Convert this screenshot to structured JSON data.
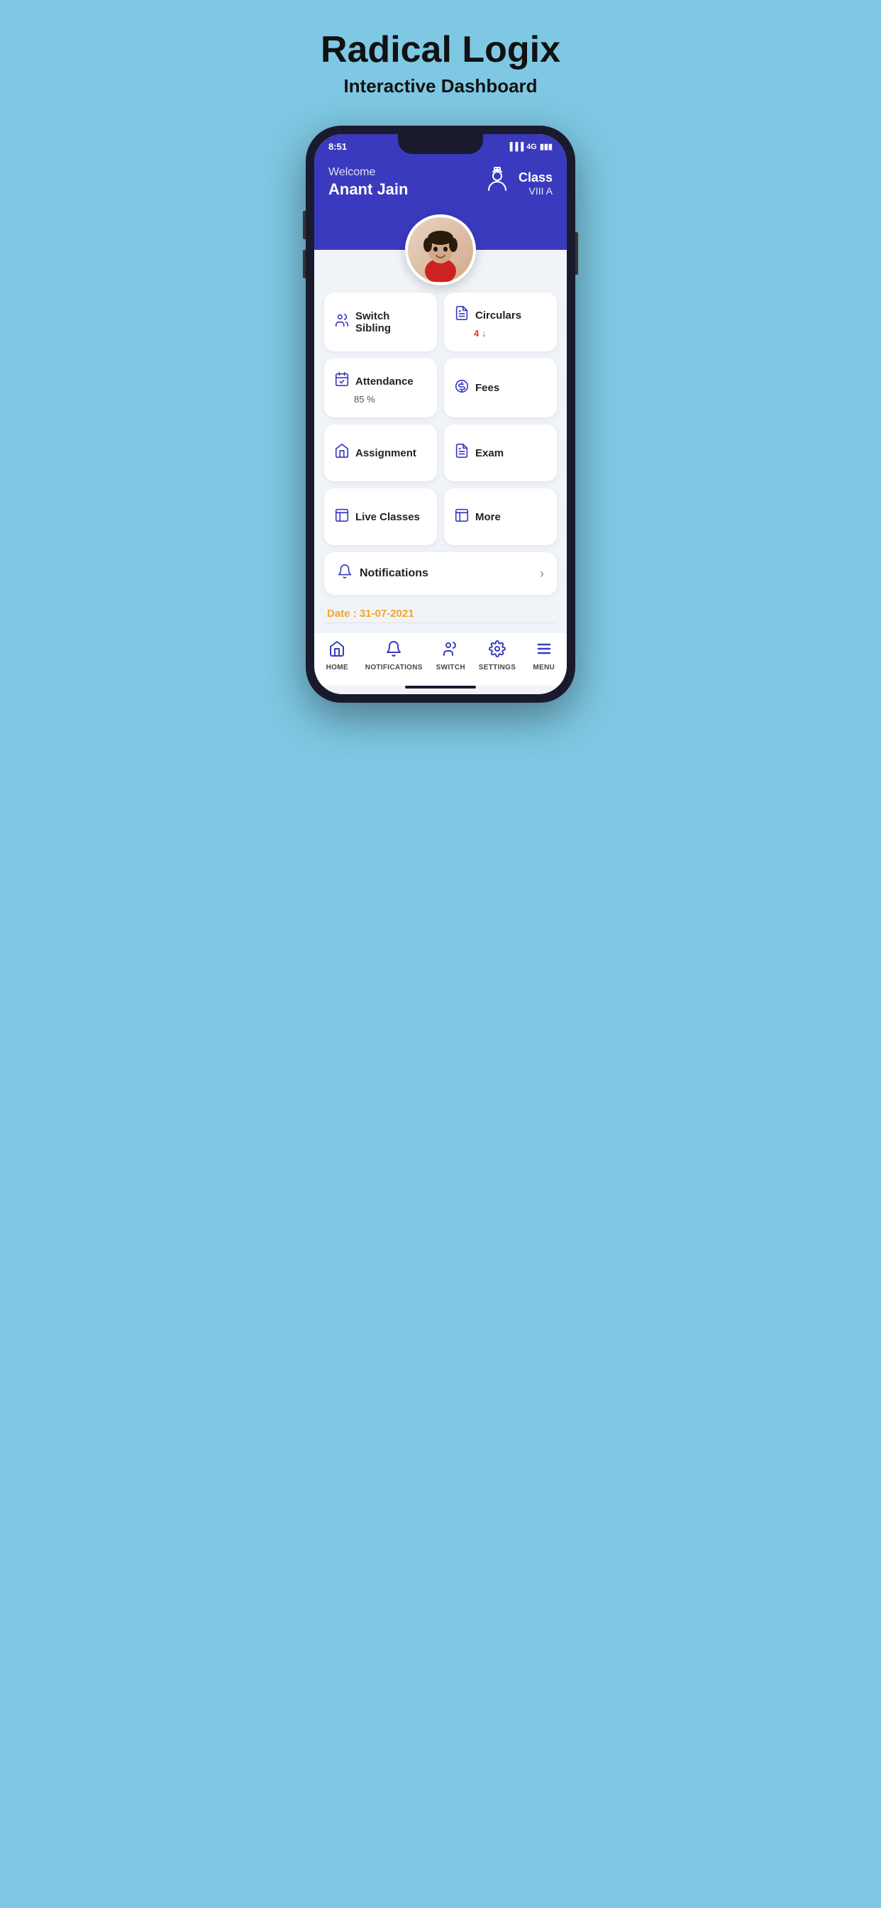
{
  "header": {
    "title": "Radical Logix",
    "subtitle_normal": "Interactive ",
    "subtitle_bold": "Dashboard"
  },
  "status_bar": {
    "time": "8:51",
    "network": "4G"
  },
  "user": {
    "welcome": "Welcome",
    "name": "Anant  Jain",
    "class_label": "Class",
    "class_value": "VIII A"
  },
  "grid_items": [
    {
      "label": "Switch Sibling",
      "sub": "",
      "icon": "switch-sibling"
    },
    {
      "label": "Circulars",
      "sub": "4 ↓",
      "icon": "circulars"
    },
    {
      "label": "Attendance",
      "sub": "85 %",
      "icon": "attendance"
    },
    {
      "label": "Fees",
      "sub": "",
      "icon": "fees"
    },
    {
      "label": "Assignment",
      "sub": "",
      "icon": "assignment"
    },
    {
      "label": "Exam",
      "sub": "",
      "icon": "exam"
    },
    {
      "label": "Live Classes",
      "sub": "",
      "icon": "live-classes"
    },
    {
      "label": "More",
      "sub": "",
      "icon": "more"
    }
  ],
  "notifications": {
    "label": "Notifications"
  },
  "date_bar": {
    "text": "Date : 31-07-2021"
  },
  "bottom_nav": [
    {
      "label": "HOME",
      "icon": "home"
    },
    {
      "label": "NOTIFICATIONS",
      "icon": "bell"
    },
    {
      "label": "SWITCH",
      "icon": "switch"
    },
    {
      "label": "SETTINGS",
      "icon": "settings"
    },
    {
      "label": "MENU",
      "icon": "menu"
    }
  ]
}
